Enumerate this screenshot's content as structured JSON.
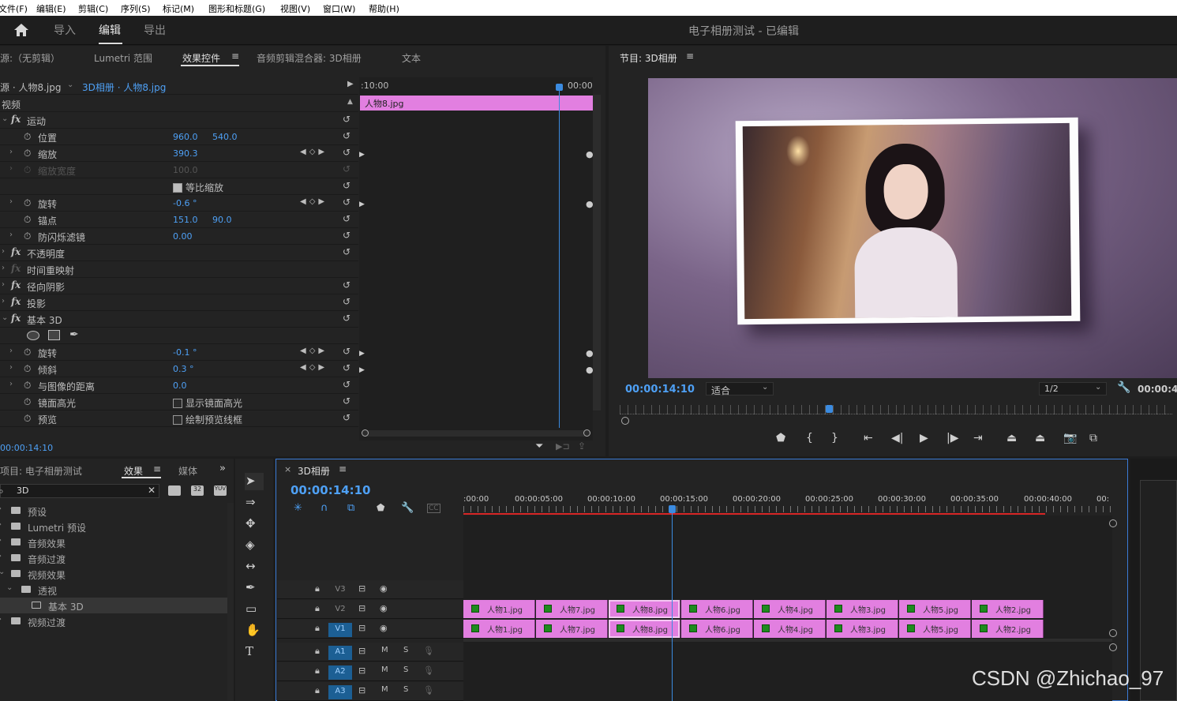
{
  "menubar": [
    "文件(F)",
    "编辑(E)",
    "剪辑(C)",
    "序列(S)",
    "标记(M)",
    "图形和标题(G)",
    "视图(V)",
    "窗口(W)",
    "帮助(H)"
  ],
  "header": {
    "nav": [
      "导入",
      "编辑",
      "导出"
    ],
    "active_nav": "编辑",
    "project_title": "电子相册测试 - 已编辑"
  },
  "top_tabs": [
    "源:（无剪辑）",
    "Lumetri 范围",
    "效果控件",
    "音频剪辑混合器: 3D相册",
    "文本"
  ],
  "effect_controls": {
    "source_clip": "源 · 人物8.jpg",
    "seq_clip": "3D相册 · 人物8.jpg",
    "mini_time_left": ":10:00",
    "mini_time_right": "00:00",
    "mini_clip_label": "人物8.jpg",
    "section_video": "视频",
    "rows": {
      "motion": "运动",
      "position": "位置",
      "position_x": "960.0",
      "position_y": "540.0",
      "scale": "缩放",
      "scale_v": "390.3",
      "scale_w": "缩放宽度",
      "scale_w_v": "100.0",
      "uniform": "等比缩放",
      "rotation": "旋转",
      "rotation_v": "-0.6 °",
      "anchor": "锚点",
      "anchor_x": "151.0",
      "anchor_y": "90.0",
      "flicker": "防闪烁滤镜",
      "flicker_v": "0.00",
      "opacity": "不透明度",
      "time_remap": "时间重映射",
      "radial_shadow": "径向阴影",
      "drop_shadow": "投影",
      "basic3d": "基本 3D",
      "b3d_rotate": "旋转",
      "b3d_rotate_v": "-0.1 °",
      "b3d_tilt": "倾斜",
      "b3d_tilt_v": "0.3 °",
      "b3d_distance": "与图像的距离",
      "b3d_distance_v": "0.0",
      "b3d_specular": "镜面高光",
      "b3d_specular_cb": "显示镜面高光",
      "b3d_preview": "预览",
      "b3d_preview_cb": "绘制预览线框"
    },
    "timecode": "00:00:14:10"
  },
  "program": {
    "tab": "节目: 3D相册",
    "timecode": "00:00:14:10",
    "fit": "适合",
    "resolution": "1/2",
    "duration": "00:00:4"
  },
  "project_panel": {
    "tabs": [
      "项目: 电子相册测试",
      "效果",
      "媒体"
    ],
    "search": "3D",
    "tree": [
      {
        "label": "预设",
        "indent": 0,
        "icon": "preset-folder-icon"
      },
      {
        "label": "Lumetri 预设",
        "indent": 0,
        "icon": "preset-folder-icon"
      },
      {
        "label": "音频效果",
        "indent": 0,
        "icon": "folder-icon"
      },
      {
        "label": "音频过渡",
        "indent": 0,
        "icon": "folder-icon"
      },
      {
        "label": "视频效果",
        "indent": 0,
        "icon": "folder-icon"
      },
      {
        "label": "透视",
        "indent": 1,
        "icon": "folder-icon"
      },
      {
        "label": "基本 3D",
        "indent": 2,
        "icon": "effect-icon"
      },
      {
        "label": "视频过渡",
        "indent": 0,
        "icon": "folder-icon"
      }
    ]
  },
  "timeline": {
    "tab": "3D相册",
    "timecode": "00:00:14:10",
    "ruler": [
      ":00:00",
      "00:00:05:00",
      "00:00:10:00",
      "00:00:15:00",
      "00:00:20:00",
      "00:00:25:00",
      "00:00:30:00",
      "00:00:35:00",
      "00:00:40:00",
      "00:"
    ],
    "tracks": [
      "V3",
      "V2",
      "V1",
      "A1",
      "A2",
      "A3"
    ],
    "audio_m": "M",
    "audio_s": "S",
    "v2_clips": [
      "人物1.jpg",
      "人物7.jpg",
      "人物8.jpg",
      "人物6.jpg",
      "人物4.jpg",
      "人物3.jpg",
      "人物5.jpg",
      "人物2.jpg"
    ],
    "v1_clips": [
      "人物1.jpg",
      "人物7.jpg",
      "人物8.jpg",
      "人物6.jpg",
      "人物4.jpg",
      "人物3.jpg",
      "人物5.jpg",
      "人物2.jpg"
    ]
  },
  "watermark": "CSDN @Zhichao_97",
  "colors": {
    "accent": "#4ea0f5",
    "clip": "#e27fe0",
    "selected_track": "#1c5f94",
    "work_area": "#d62525"
  }
}
